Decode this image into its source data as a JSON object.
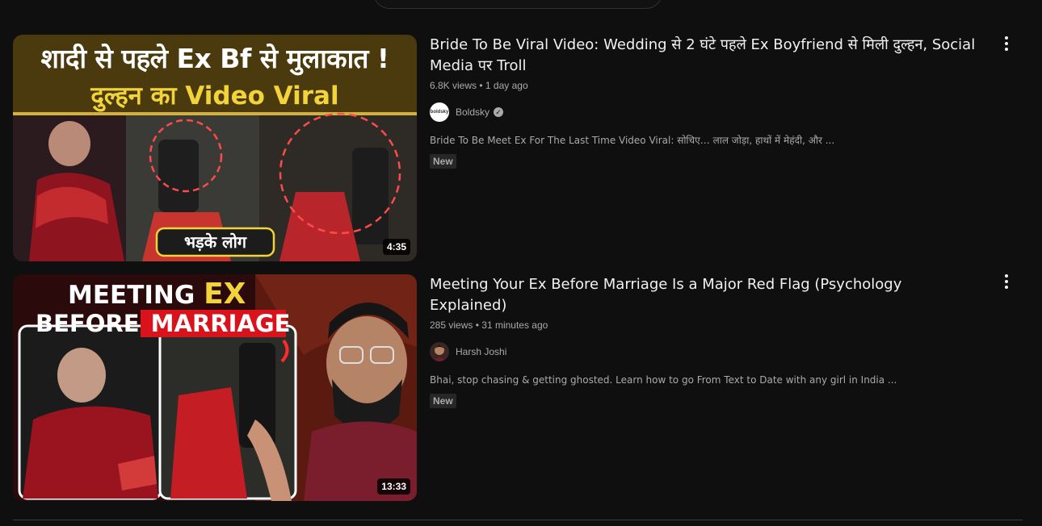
{
  "results": [
    {
      "title": "Bride To Be Viral Video: Wedding से 2 घंटे पहले Ex Boyfriend से मिली दुल्हन, Social Media पर Troll",
      "views": "6.8K views",
      "age": "1 day ago",
      "channel": "Boldsky",
      "channel_avatar_text": "boldsky",
      "description": "Bride To Be Meet Ex For The Last Time Video Viral: सोचिए… लाल जोड़ा, हाथों में मेहंदी, और ...",
      "badge": "New",
      "duration": "4:35",
      "thumb_line1": "शादी से पहले Ex Bf से मुलाकात !",
      "thumb_line2": "दुल्हन का Video Viral",
      "thumb_caption": "भड़के लोग",
      "verified_icon": "check"
    },
    {
      "title": "Meeting Your Ex Before Marriage Is a Major Red Flag (Psychology Explained)",
      "views": "285 views",
      "age": "31 minutes ago",
      "channel": "Harsh Joshi",
      "description": "Bhai, stop chasing & getting ghosted. Learn how to go From Text to Date with any girl in India ...",
      "badge": "New",
      "duration": "13:33",
      "thumb_line1a": "MEETING",
      "thumb_line1b": "EX",
      "thumb_line2a": "BEFORE",
      "thumb_line2b": "MARRIAGE"
    }
  ],
  "meta_separator": "•"
}
